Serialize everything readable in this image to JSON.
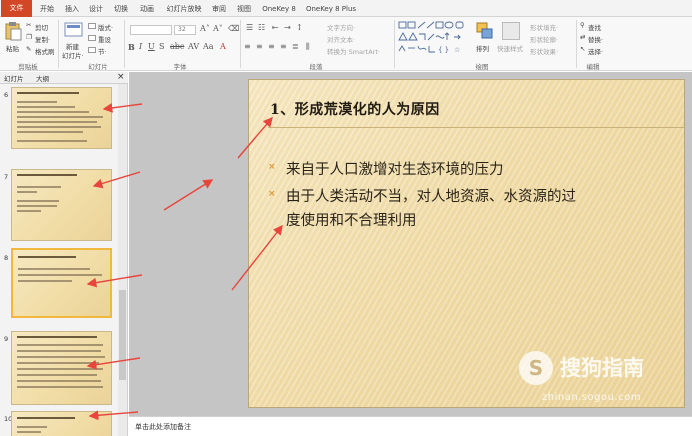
{
  "app": {
    "doc_title_partial": ""
  },
  "tabs": [
    "文件",
    "开始",
    "插入",
    "设计",
    "切换",
    "动画",
    "幻灯片放映",
    "审阅",
    "视图",
    "OneKey 8",
    "OneKey 8 Plus"
  ],
  "ribbon": {
    "clipboard": {
      "paste": "粘贴",
      "cut": "剪切",
      "copy": "复制·",
      "format_painter": "格式刷",
      "label": "剪贴板"
    },
    "slides": {
      "new_slide": "新建",
      "new_slide_2": "幻灯片·",
      "layout": "版式·",
      "reset": "重设",
      "section": "节·",
      "label": "幻灯片"
    },
    "font": {
      "size": "32",
      "label": "字体"
    },
    "paragraph": {
      "text_direction": "文字方向·",
      "align_text": "对齐文本·",
      "smartart": "转换为 SmartArt·",
      "label": "段落"
    },
    "drawing": {
      "arrange": "排列",
      "quick_styles": "快速样式",
      "fill": "形状填充·",
      "outline": "形状轮廓·",
      "effects": "形状效果·",
      "label": "绘图"
    },
    "editing": {
      "find": "查找",
      "replace": "替换·",
      "select": "选择·",
      "label": "编辑"
    }
  },
  "pane": {
    "tab_slides": "幻灯片",
    "tab_outline": "大纲",
    "close": "×"
  },
  "thumbnails": [
    {
      "num": "6"
    },
    {
      "num": "7"
    },
    {
      "num": "8"
    },
    {
      "num": "9"
    },
    {
      "num": "10"
    }
  ],
  "slide": {
    "title": "1、形成荒漠化的人为原因",
    "bullets": [
      "来自于人口激增对生态环境的压力",
      "由于人类活动不当，对人地资源、水资源的过",
      "度使用和不合理利用"
    ],
    "bullet_char": "×"
  },
  "notes": {
    "placeholder": "单击此处添加备注"
  },
  "watermark": {
    "name": "搜狗指南",
    "url": "zhinan.sogou.com"
  },
  "colors": {
    "file_tab": "#d24726",
    "arrow": "#e8453c",
    "slide_bg": "#f1ddaa",
    "bullet": "#d99a35"
  }
}
